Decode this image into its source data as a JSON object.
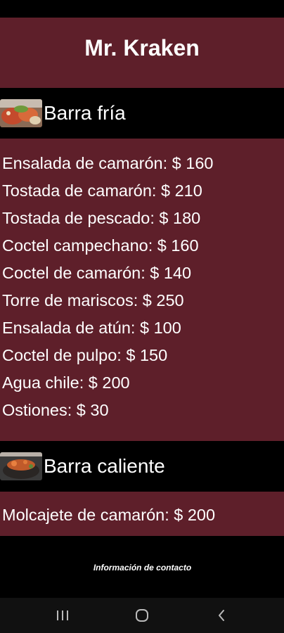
{
  "app": {
    "title": "Mr. Kraken"
  },
  "sections": [
    {
      "title": "Barra fría",
      "items": [
        "Ensalada de camarón: $ 160",
        "Tostada de camarón: $ 210",
        "Tostada de pescado: $ 180",
        "Coctel campechano: $ 160",
        "Coctel de camarón: $ 140",
        "Torre de mariscos: $ 250",
        "Ensalada de atún: $ 100",
        "Coctel de pulpo: $ 150",
        "Agua chile: $ 200",
        "Ostiones: $ 30"
      ]
    },
    {
      "title": "Barra caliente",
      "items": [
        "Molcajete de camarón: $ 200"
      ]
    }
  ],
  "footer": {
    "contact_label": "Información de contacto"
  },
  "colors": {
    "primary": "#5e1f2a",
    "dark": "#000000"
  },
  "icons": {
    "recent_apps": "recent-apps-icon",
    "home": "home-icon",
    "back": "back-icon"
  }
}
